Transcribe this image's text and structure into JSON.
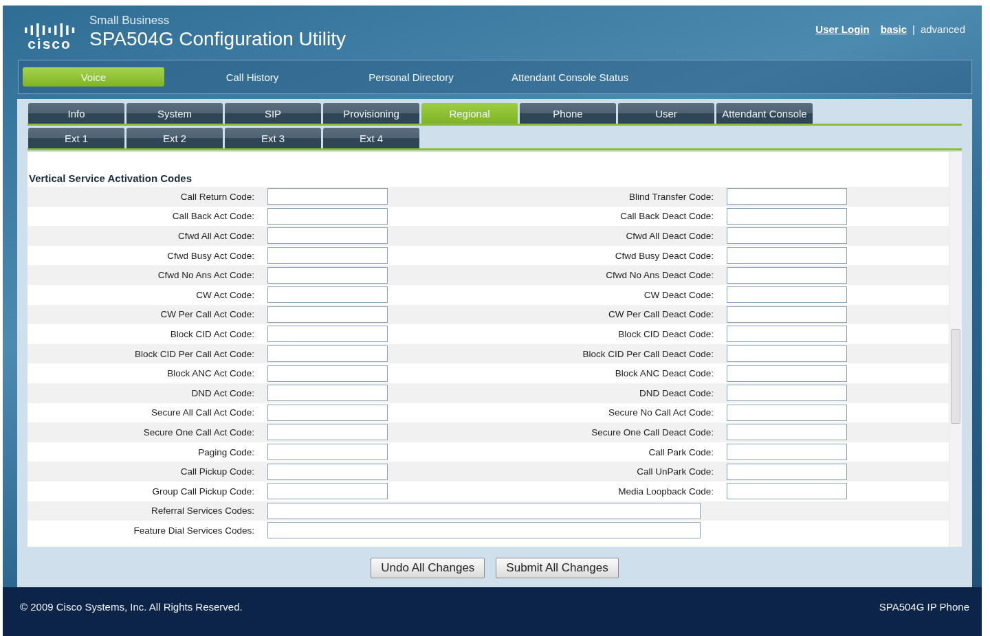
{
  "header": {
    "logo_text": "cisco",
    "tagline": "Small Business",
    "title": "SPA504G Configuration Utility",
    "links": [
      {
        "label": "User Login",
        "kind": "link"
      },
      {
        "label": "basic",
        "kind": "link"
      },
      {
        "label": "|",
        "kind": "separator"
      },
      {
        "label": "advanced",
        "kind": "text"
      }
    ]
  },
  "main_nav": [
    {
      "label": "Voice",
      "selected": true
    },
    {
      "label": "Call History",
      "selected": false
    },
    {
      "label": "Personal Directory",
      "selected": false
    },
    {
      "label": "Attendant Console Status",
      "selected": false
    }
  ],
  "tabs": [
    {
      "label": "Info",
      "selected": false
    },
    {
      "label": "System",
      "selected": false
    },
    {
      "label": "SIP",
      "selected": false
    },
    {
      "label": "Provisioning",
      "selected": false
    },
    {
      "label": "Regional",
      "selected": true
    },
    {
      "label": "Phone",
      "selected": false
    },
    {
      "label": "User",
      "selected": false
    },
    {
      "label": "Attendant Console",
      "selected": false
    }
  ],
  "sub_tabs": [
    {
      "label": "Ext 1",
      "selected": false
    },
    {
      "label": "Ext 2",
      "selected": false
    },
    {
      "label": "Ext 3",
      "selected": false
    },
    {
      "label": "Ext 4",
      "selected": false
    }
  ],
  "section": {
    "title": "Vertical Service Activation Codes",
    "rows": [
      {
        "left": "Call Return Code:",
        "right": "Blind Transfer Code:"
      },
      {
        "left": "Call Back Act Code:",
        "right": "Call Back Deact Code:"
      },
      {
        "left": "Cfwd All Act Code:",
        "right": "Cfwd All Deact Code:"
      },
      {
        "left": "Cfwd Busy Act Code:",
        "right": "Cfwd Busy Deact Code:"
      },
      {
        "left": "Cfwd No Ans Act Code:",
        "right": "Cfwd No Ans Deact Code:"
      },
      {
        "left": "CW Act Code:",
        "right": "CW Deact Code:"
      },
      {
        "left": "CW Per Call Act Code:",
        "right": "CW Per Call Deact Code:"
      },
      {
        "left": "Block CID Act Code:",
        "right": "Block CID Deact Code:"
      },
      {
        "left": "Block CID Per Call Act Code:",
        "right": "Block CID Per Call Deact Code:"
      },
      {
        "left": "Block ANC Act Code:",
        "right": "Block ANC Deact Code:"
      },
      {
        "left": "DND Act Code:",
        "right": "DND Deact Code:"
      },
      {
        "left": "Secure All Call Act Code:",
        "right": "Secure No Call Act Code:"
      },
      {
        "left": "Secure One Call Act Code:",
        "right": "Secure One Call Deact Code:"
      },
      {
        "left": "Paging Code:",
        "right": "Call Park Code:"
      },
      {
        "left": "Call Pickup Code:",
        "right": "Call UnPark Code:"
      },
      {
        "left": "Group Call Pickup Code:",
        "right": "Media Loopback Code:"
      }
    ],
    "wide_rows": [
      {
        "label": "Referral Services Codes:"
      },
      {
        "label": "Feature Dial Services Codes:"
      }
    ]
  },
  "buttons": [
    "Undo All Changes",
    "Submit All Changes"
  ],
  "footer": {
    "copyright": "© 2009 Cisco Systems, Inc. All Rights Reserved.",
    "model": "SPA504G IP Phone"
  }
}
